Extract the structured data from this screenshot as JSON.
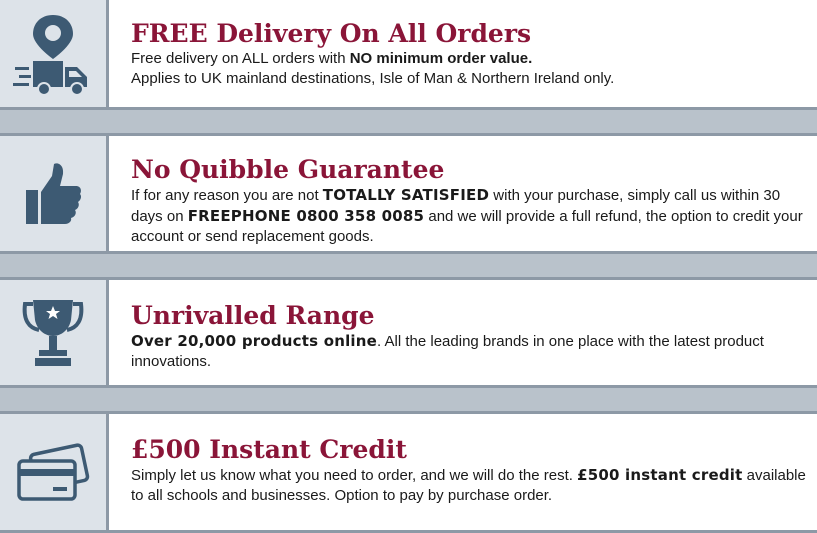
{
  "panels": [
    {
      "icon": "delivery-truck-icon",
      "title": "FREE Delivery On All Orders",
      "line1_pre": "Free delivery on ALL orders with ",
      "line1_bold": "NO minimum order value.",
      "line2": "Applies to UK mainland destinations, Isle of Man & Northern Ireland only."
    },
    {
      "icon": "thumbs-up-icon",
      "title": "No Quibble Guarantee",
      "seg1": "If for any reason you are not ",
      "bold1": "TOTALLY SATISFIED",
      "seg2": " with your purchase, simply call us within 30 days on ",
      "bold2": "FREEPHONE 0800 358 0085",
      "seg3": " and we will provide a full refund, the option to credit your account or send replacement goods."
    },
    {
      "icon": "trophy-icon",
      "title": "Unrivalled Range",
      "bold1": "Over 20,000 products online",
      "seg1": ".  All the leading brands in one place with the latest product innovations."
    },
    {
      "icon": "credit-card-icon",
      "title": "£500 Instant Credit",
      "seg1": "Simply let us know what you need to order, and we will do the rest. ",
      "bold1": "£500 instant credit",
      "seg2": " available to all schools and businesses. Option to pay by purchase order."
    }
  ],
  "colors": {
    "title": "#8a1538",
    "icon": "#3d5a73",
    "background": "#b9c2cb",
    "icon_cell": "#dde3e9",
    "border": "#8d99a6"
  }
}
